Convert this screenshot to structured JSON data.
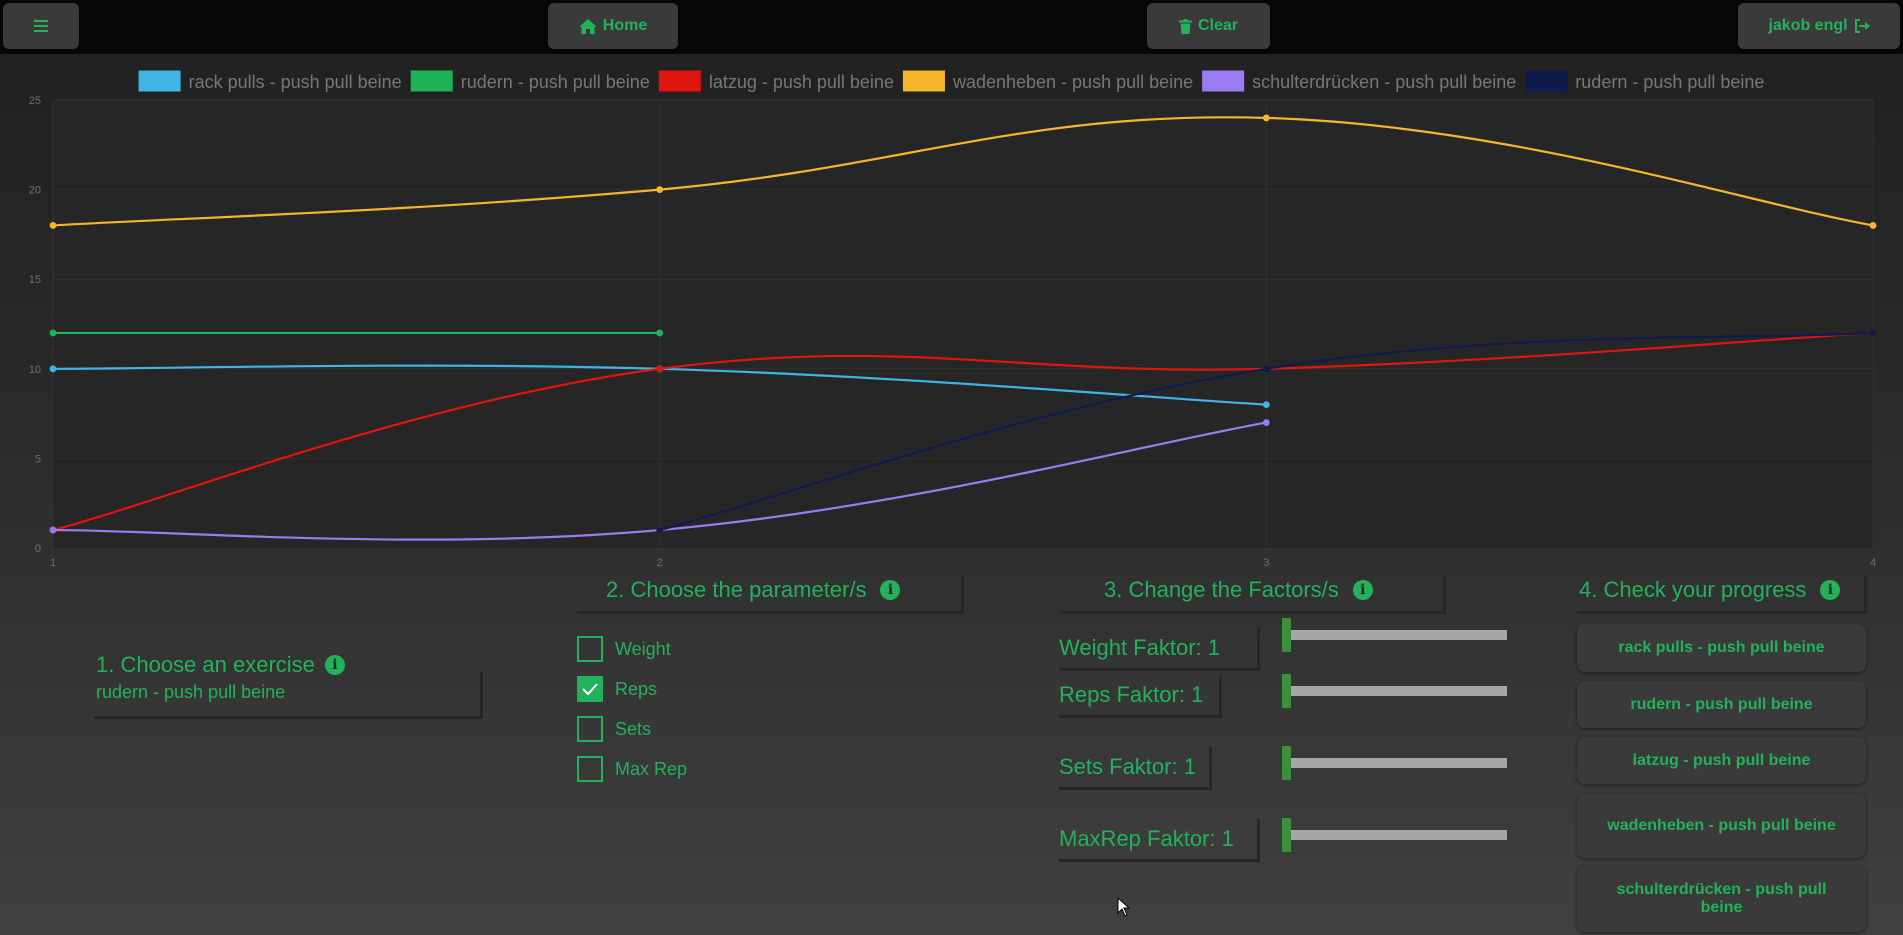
{
  "topbar": {
    "menu_icon": "hamburger-icon",
    "home_label": "Home",
    "home_icon": "home-icon",
    "clear_label": "Clear",
    "clear_icon": "trash-icon",
    "user_label": "jakob engl",
    "user_icon": "sign-out-icon"
  },
  "colors": {
    "accent": "#22b35a",
    "topbar": "#070707",
    "button": "#3a3a3a"
  },
  "chart_data": {
    "type": "line",
    "x": [
      1,
      2,
      3,
      4
    ],
    "xticks": [
      "1",
      "2",
      "3",
      "4"
    ],
    "ylim": [
      0,
      25
    ],
    "yticks": [
      "0",
      "5",
      "10",
      "15",
      "20",
      "25"
    ],
    "grid": true,
    "legend": "top",
    "series": [
      {
        "name": "rack pulls - push pull beine",
        "color": "#3fb5e5",
        "values": [
          10,
          10,
          8
        ]
      },
      {
        "name": "rudern - push pull beine",
        "color": "#1fb357",
        "values": [
          12,
          12
        ]
      },
      {
        "name": "latzug - push pull beine",
        "color": "#e0150f",
        "values": [
          1,
          10,
          10,
          12
        ]
      },
      {
        "name": "wadenheben - push pull beine",
        "color": "#f5b62c",
        "values": [
          18,
          20,
          24,
          18
        ]
      },
      {
        "name": "schulterdrücken - push pull beine",
        "color": "#9a7cf0",
        "values": [
          1,
          1,
          7
        ]
      },
      {
        "name": "rudern - push pull beine",
        "color": "#0f1a4d",
        "values": [
          null,
          1,
          10,
          12
        ]
      }
    ]
  },
  "step1": {
    "title": "1. Choose an exercise",
    "selected_exercise": "rudern - push pull beine"
  },
  "step2": {
    "title": "2. Choose the parameter/s",
    "params": [
      {
        "label": "Weight",
        "checked": false
      },
      {
        "label": "Reps",
        "checked": true
      },
      {
        "label": "Sets",
        "checked": false
      },
      {
        "label": "Max Rep",
        "checked": false
      }
    ]
  },
  "step3": {
    "title": "3. Change the Factors/s",
    "factors": [
      {
        "label": "Weight Faktor: 1",
        "value": 1
      },
      {
        "label": "Reps Faktor: 1",
        "value": 1
      },
      {
        "label": "Sets Faktor: 1",
        "value": 1
      },
      {
        "label": "MaxRep Faktor: 1",
        "value": 1
      }
    ]
  },
  "step4": {
    "title": "4. Check your progress",
    "buttons": [
      "rack pulls - push pull beine",
      "rudern - push pull beine",
      "latzug - push pull beine",
      "wadenheben - push pull beine",
      "schulterdrücken - push pull beine"
    ]
  }
}
